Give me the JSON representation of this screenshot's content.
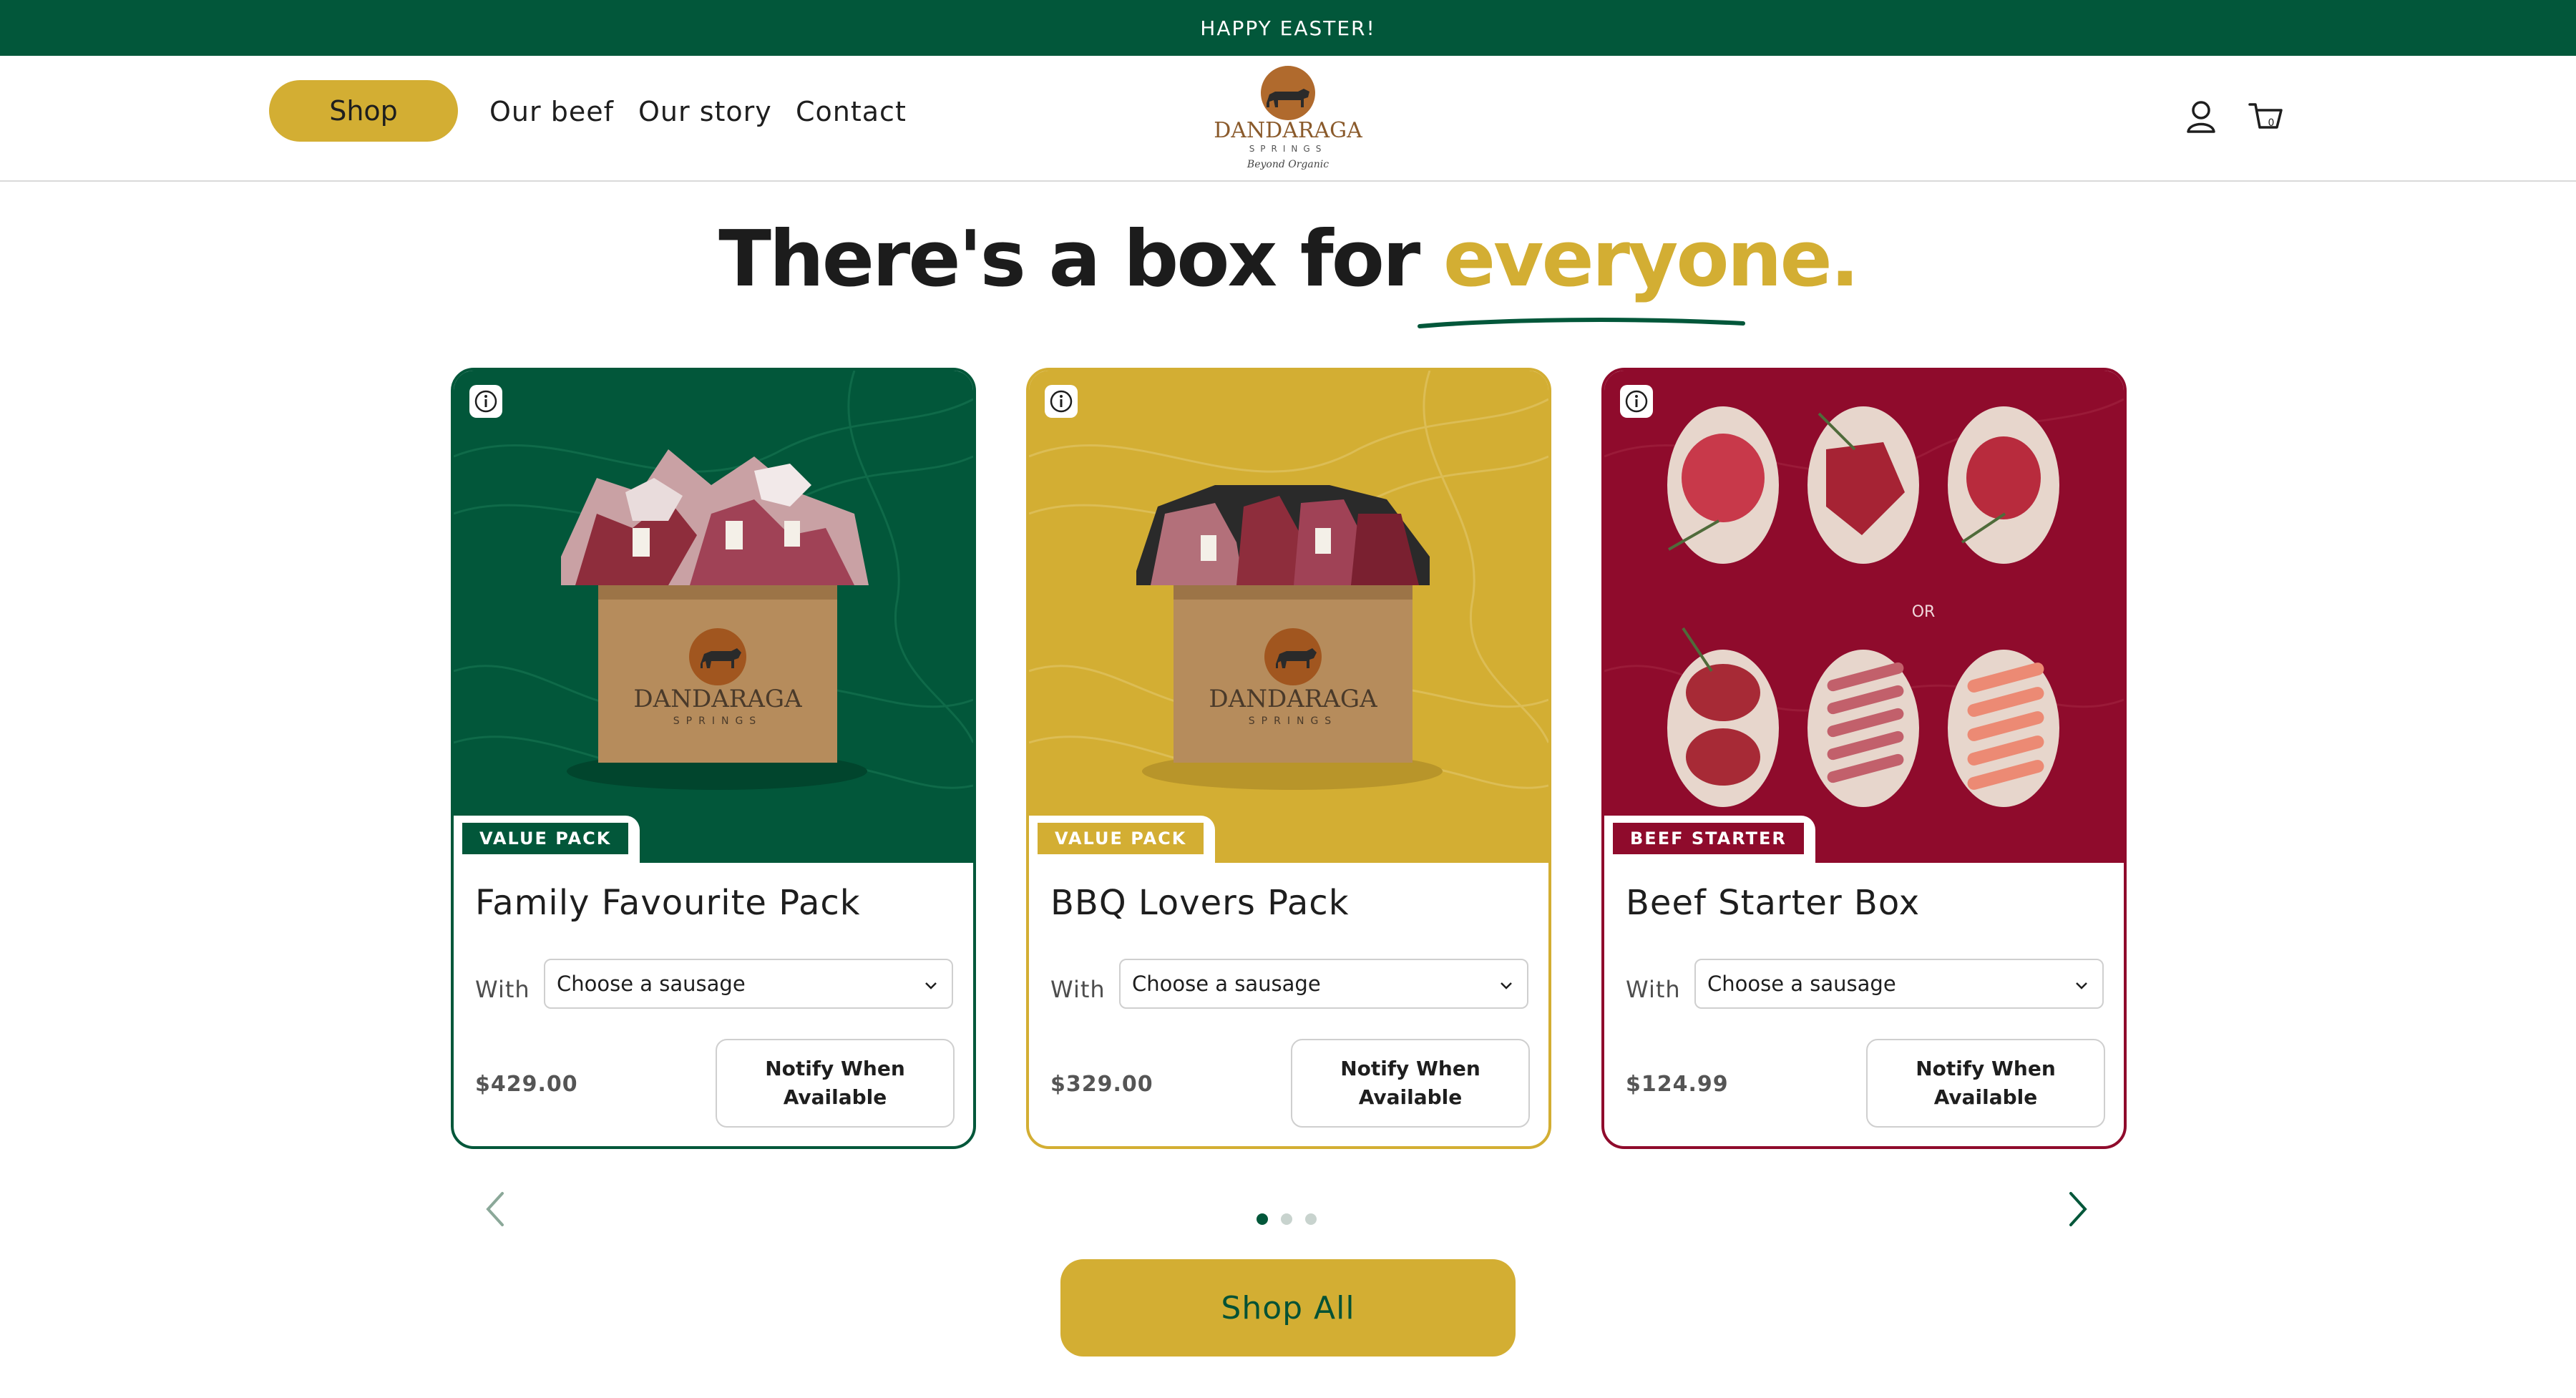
{
  "announcement": {
    "text": "HAPPY EASTER!"
  },
  "header": {
    "nav": {
      "shop": "Shop",
      "our_beef": "Our beef",
      "our_story": "Our story",
      "contact": "Contact"
    },
    "logo": {
      "name": "DANDARAGA",
      "sub": "SPRINGS",
      "tagline": "Beyond Organic"
    },
    "icons": [
      "account-icon",
      "cart-icon"
    ],
    "cart_count": "0"
  },
  "heading": {
    "main": "There's a box for ",
    "accent": "everyone."
  },
  "cards": [
    {
      "theme_color": "#02573a",
      "badge": "VALUE PACK",
      "title": "Family Favourite Pack",
      "with_label": "With",
      "select_value": "Choose a sausage",
      "price": "$429.00",
      "button": "Notify When Available",
      "box_brand": "DANDARAGA",
      "box_sub": "SPRINGS"
    },
    {
      "theme_color": "#d3ae33",
      "badge": "VALUE PACK",
      "title": "BBQ Lovers Pack",
      "with_label": "With",
      "select_value": "Choose a sausage",
      "price": "$329.00",
      "button": "Notify When Available",
      "box_brand": "DANDARAGA",
      "box_sub": "SPRINGS"
    },
    {
      "theme_color": "#8f0b2c",
      "badge": "BEEF STARTER",
      "title": "Beef Starter Box",
      "with_label": "With",
      "select_value": "Choose a sausage",
      "price": "$124.99",
      "button": "Notify When Available",
      "or_label": "OR"
    }
  ],
  "carousel": {
    "active_dot": 1,
    "dot_count": 3
  },
  "cta": {
    "shop_all": "Shop All"
  },
  "colors": {
    "brand_green": "#02573a",
    "brand_gold": "#d3ae33",
    "brand_red": "#8f0b2c"
  }
}
